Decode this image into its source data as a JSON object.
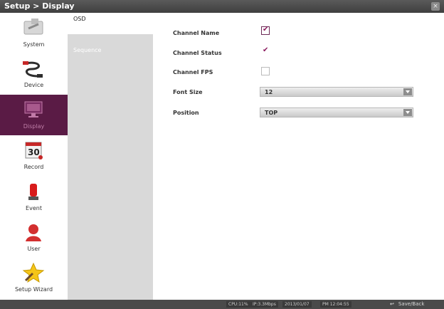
{
  "window": {
    "title": "Setup > Display",
    "close_icon": "close-icon"
  },
  "sidebar": {
    "items": [
      {
        "label": "System",
        "icon": "system-icon"
      },
      {
        "label": "Device",
        "icon": "device-icon"
      },
      {
        "label": "Display",
        "icon": "display-icon",
        "active": true
      },
      {
        "label": "Record",
        "icon": "record-icon"
      },
      {
        "label": "Event",
        "icon": "event-icon"
      },
      {
        "label": "User",
        "icon": "user-icon"
      },
      {
        "label": "Setup Wizard",
        "icon": "setup-wizard-icon"
      }
    ]
  },
  "tabs": [
    {
      "label": "OSD",
      "active": true
    },
    {
      "label": "Sequence",
      "active": false
    }
  ],
  "settings": {
    "channel_name": {
      "label": "Channel Name",
      "checked": true
    },
    "channel_status": {
      "label": "Channel Status",
      "checked": true
    },
    "channel_fps": {
      "label": "Channel FPS",
      "checked": false
    },
    "font_size": {
      "label": "Font Size",
      "value": "12"
    },
    "position": {
      "label": "Position",
      "value": "TOP"
    }
  },
  "statusbar": {
    "cpu": "CPU:11%",
    "ip": "IP:3.3Mbps",
    "date": "2013/01/07",
    "time": "PM 12:04:55",
    "save_label": "Save/Back"
  },
  "colors": {
    "accent": "#5a1b45",
    "check": "#8b1a5e"
  }
}
